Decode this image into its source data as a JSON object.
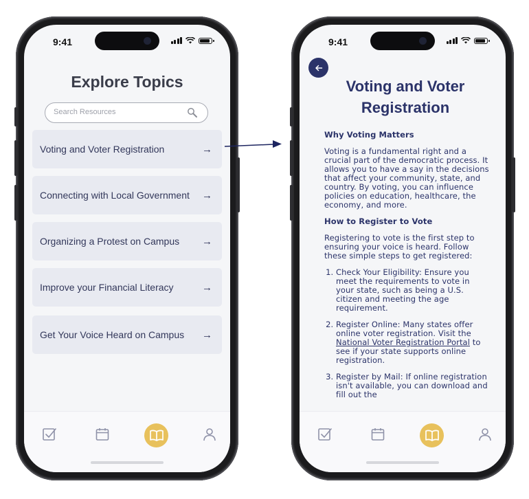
{
  "status": {
    "time": "9:41"
  },
  "left": {
    "title": "Explore Topics",
    "search_placeholder": "Search Resources",
    "topics": [
      "Voting and Voter Registration",
      "Connecting with Local Government",
      "Organizing a Protest on Campus",
      "Improve your Financial Literacy",
      "Get Your Voice Heard on Campus"
    ],
    "arrow": "→"
  },
  "right": {
    "title_line1": "Voting and Voter",
    "title_line2": "Registration",
    "section1_heading": "Why Voting Matters",
    "section1_body": "Voting is a fundamental right and a crucial part of the democratic process. It allows you to have a say in the decisions that affect your community, state, and country. By voting, you can influence policies on education, healthcare, the economy, and more.",
    "section2_heading": "How to Register to Vote",
    "section2_body": "Registering to vote is the first step to ensuring your voice is heard. Follow these simple steps to get registered:",
    "step1": "Check Your Eligibility: Ensure you meet the requirements to vote in your state, such as being a U.S. citizen and meeting the age requirement.",
    "step2_pre": "Register Online: Many states offer online voter registration. Visit the ",
    "step2_link": "National Voter Registration Portal",
    "step2_post": " to see if your state supports online registration.",
    "step3": "Register by Mail: If online registration isn't available, you can download and fill out the"
  },
  "tabbar": {
    "icons": [
      "checkbox-icon",
      "calendar-icon",
      "book-icon",
      "profile-icon"
    ],
    "active_color": "#e8c15c"
  },
  "colors": {
    "navy": "#2b3369",
    "card": "#e8eaf1",
    "accent": "#e8c15c"
  }
}
